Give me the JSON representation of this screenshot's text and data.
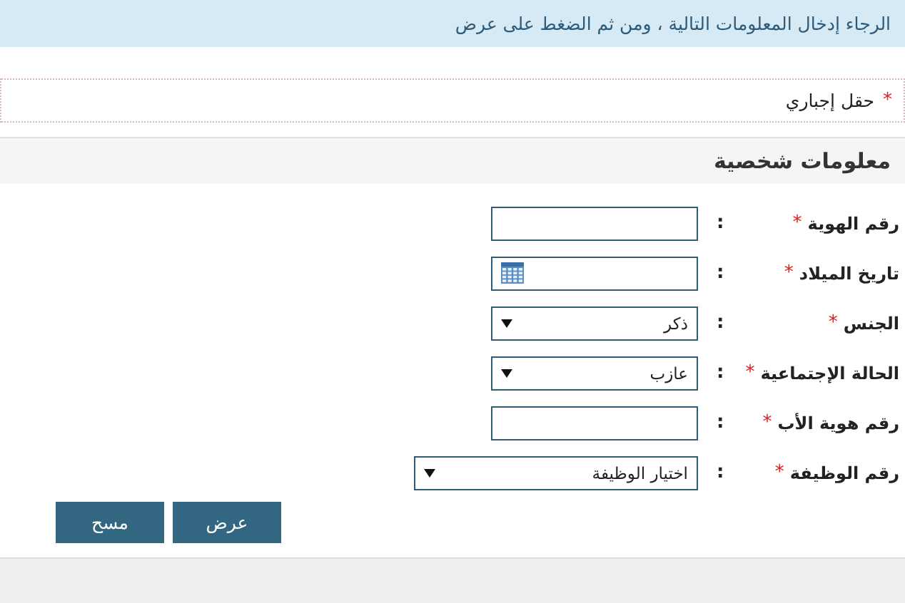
{
  "header": {
    "instruction": "الرجاء إدخال المعلومات التالية ، ومن ثم الضغط على عرض"
  },
  "required_note": {
    "mark": "*",
    "text": "حقل إجباري"
  },
  "section": {
    "title": "معلومات شخصية"
  },
  "fields": [
    {
      "kind": "text",
      "label": "رقم الهوية",
      "mark": "*",
      "colon": ":"
    },
    {
      "kind": "date",
      "label": "تاريخ الميلاد",
      "mark": "*",
      "colon": ":"
    },
    {
      "kind": "select",
      "label": "الجنس",
      "mark": "*",
      "colon": ":",
      "value": "ذكر"
    },
    {
      "kind": "select",
      "label": "الحالة الإجتماعية",
      "mark": "*",
      "colon": ":",
      "value": "عازب"
    },
    {
      "kind": "text",
      "label": "رقم هوية الأب",
      "mark": "*",
      "colon": ":"
    },
    {
      "kind": "wide_select",
      "label": "رقم الوظيفة",
      "mark": "*",
      "colon": ":",
      "value": "اختيار الوظيفة"
    }
  ],
  "buttons": [
    {
      "label": "عرض"
    },
    {
      "label": "مسح"
    }
  ]
}
